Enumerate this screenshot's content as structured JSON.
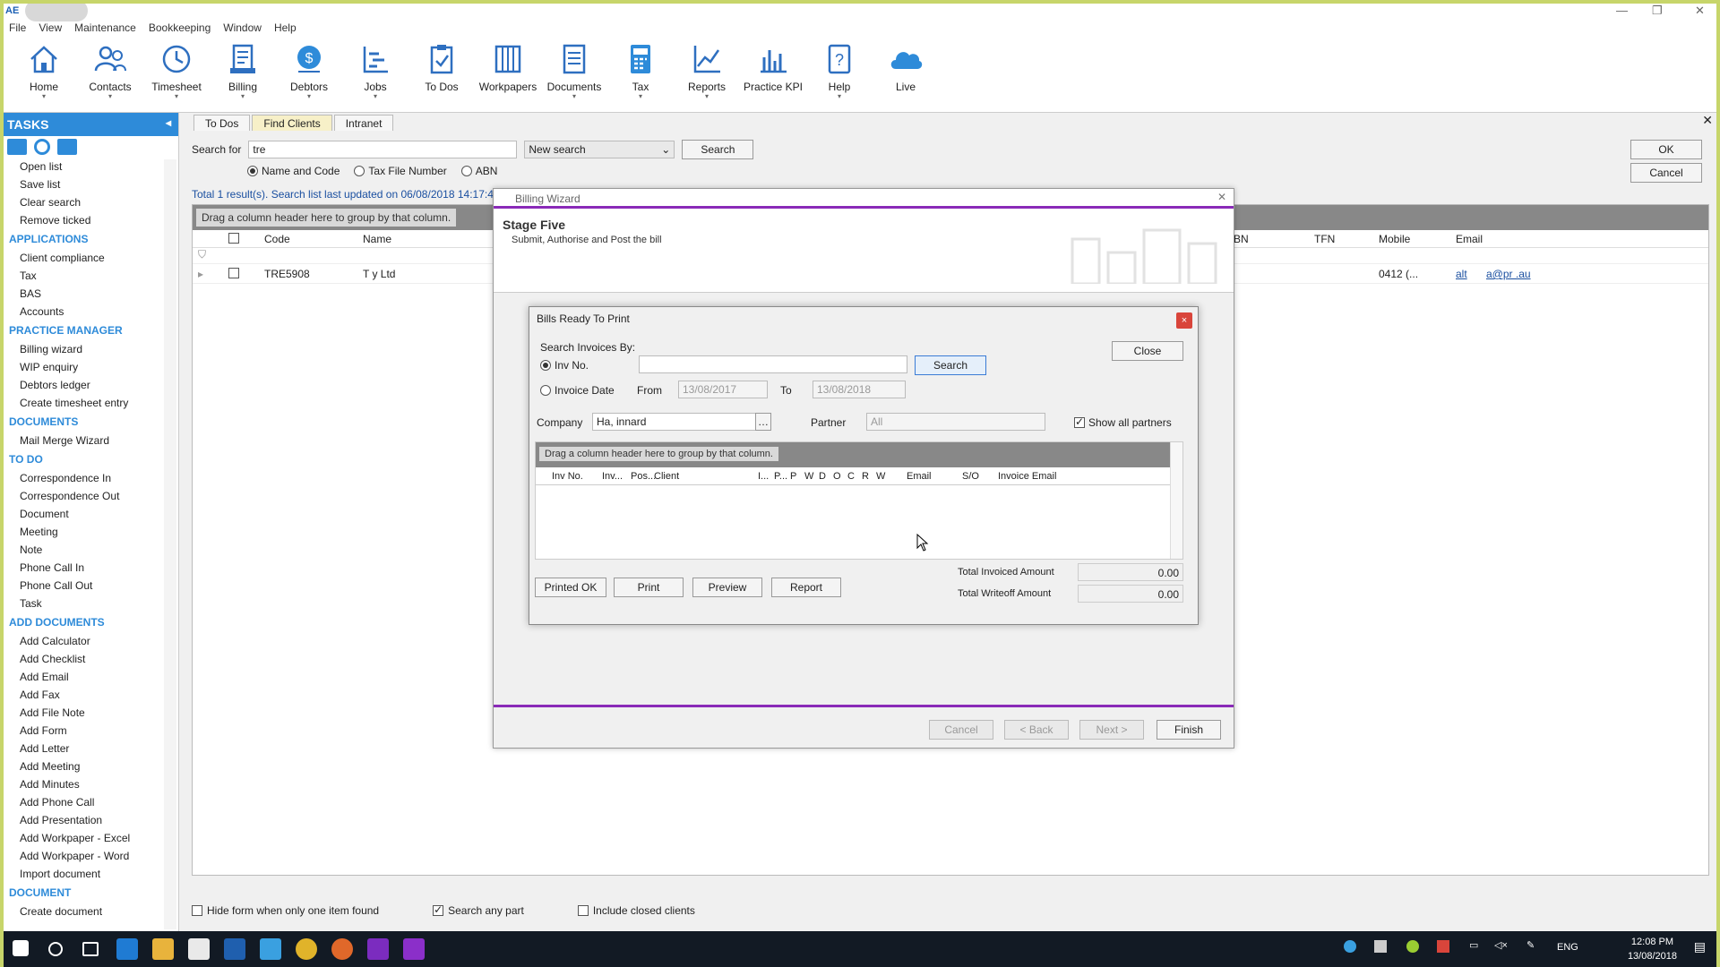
{
  "window": {
    "title_badge": "AE",
    "controls": [
      "—",
      "❐",
      "✕"
    ]
  },
  "menu": [
    "File",
    "View",
    "Maintenance",
    "Bookkeeping",
    "Window",
    "Help"
  ],
  "ribbon": [
    {
      "label": "Home",
      "icon": "home-icon"
    },
    {
      "label": "Contacts",
      "icon": "contacts-icon"
    },
    {
      "label": "Timesheet",
      "icon": "clock-icon"
    },
    {
      "label": "Billing",
      "icon": "billing-icon"
    },
    {
      "label": "Debtors",
      "icon": "debtors-icon"
    },
    {
      "label": "Jobs",
      "icon": "jobs-icon"
    },
    {
      "label": "To Dos",
      "icon": "todos-icon"
    },
    {
      "label": "Workpapers",
      "icon": "workpapers-icon"
    },
    {
      "label": "Documents",
      "icon": "documents-icon"
    },
    {
      "label": "Tax",
      "icon": "calculator-icon"
    },
    {
      "label": "Reports",
      "icon": "reports-icon"
    },
    {
      "label": "Practice KPI",
      "icon": "kpi-icon"
    },
    {
      "label": "Help",
      "icon": "help-icon"
    },
    {
      "label": "Live",
      "icon": "cloud-icon"
    }
  ],
  "sidebar": {
    "title": "TASKS",
    "entries": [
      {
        "t": "item",
        "label": "Open list"
      },
      {
        "t": "item",
        "label": "Save list"
      },
      {
        "t": "item",
        "label": "Clear search"
      },
      {
        "t": "item",
        "label": "Remove ticked"
      },
      {
        "t": "sec",
        "label": "APPLICATIONS"
      },
      {
        "t": "item",
        "label": "Client compliance"
      },
      {
        "t": "item",
        "label": "Tax"
      },
      {
        "t": "item",
        "label": "BAS"
      },
      {
        "t": "item",
        "label": "Accounts"
      },
      {
        "t": "sec",
        "label": "PRACTICE MANAGER"
      },
      {
        "t": "item",
        "label": "Billing wizard"
      },
      {
        "t": "item",
        "label": "WIP enquiry"
      },
      {
        "t": "item",
        "label": "Debtors ledger"
      },
      {
        "t": "item",
        "label": "Create timesheet entry"
      },
      {
        "t": "sec",
        "label": "DOCUMENTS"
      },
      {
        "t": "item",
        "label": "Mail Merge Wizard"
      },
      {
        "t": "sec",
        "label": "TO DO"
      },
      {
        "t": "item",
        "label": "Correspondence In"
      },
      {
        "t": "item",
        "label": "Correspondence Out"
      },
      {
        "t": "item",
        "label": "Document"
      },
      {
        "t": "item",
        "label": "Meeting"
      },
      {
        "t": "item",
        "label": "Note"
      },
      {
        "t": "item",
        "label": "Phone Call In"
      },
      {
        "t": "item",
        "label": "Phone Call Out"
      },
      {
        "t": "item",
        "label": "Task"
      },
      {
        "t": "sec",
        "label": "ADD DOCUMENTS"
      },
      {
        "t": "item",
        "label": "Add Calculator"
      },
      {
        "t": "item",
        "label": "Add Checklist"
      },
      {
        "t": "item",
        "label": "Add Email"
      },
      {
        "t": "item",
        "label": "Add Fax"
      },
      {
        "t": "item",
        "label": "Add File Note"
      },
      {
        "t": "item",
        "label": "Add Form"
      },
      {
        "t": "item",
        "label": "Add Letter"
      },
      {
        "t": "item",
        "label": "Add Meeting"
      },
      {
        "t": "item",
        "label": "Add Minutes"
      },
      {
        "t": "item",
        "label": "Add Phone Call"
      },
      {
        "t": "item",
        "label": "Add Presentation"
      },
      {
        "t": "item",
        "label": "Add Workpaper - Excel"
      },
      {
        "t": "item",
        "label": "Add Workpaper - Word"
      },
      {
        "t": "item",
        "label": "Import document"
      },
      {
        "t": "sec",
        "label": "DOCUMENT"
      },
      {
        "t": "item",
        "label": "Create document"
      }
    ]
  },
  "main": {
    "tabs": [
      "To Dos",
      "Find Clients",
      "Intranet"
    ],
    "search_label": "Search for",
    "search_value": "tre",
    "search_mode": "New search",
    "search_button": "Search",
    "ok": "OK",
    "cancel": "Cancel",
    "radios": [
      "Name and Code",
      "Tax File Number",
      "ABN"
    ],
    "status": "Total 1 result(s). Search list last updated on 06/08/2018 14:17:40",
    "group_hint": "Drag a column header here to group by that column.",
    "columns": {
      "code": "Code",
      "name": "Name",
      "abn": "BN",
      "tfn": "TFN",
      "mobile": "Mobile",
      "email": "Email"
    },
    "row": {
      "code": "TRE5908",
      "name": "T        y Ltd",
      "mobile": "0412          (...",
      "alt": "alt",
      "email": "a@pr           .au"
    },
    "footer": [
      "Hide form when only one item found",
      "Search any part",
      "Include closed clients"
    ]
  },
  "wizard": {
    "title": "Billing Wizard",
    "stage": "Stage Five",
    "subtitle": "Submit, Authorise and Post the bill",
    "buttons": [
      "Cancel",
      "< Back",
      "Next >",
      "Finish"
    ]
  },
  "bills": {
    "title": "Bills Ready To Print",
    "close_x": "×",
    "search_by": "Search Invoices By:",
    "inv_no": "Inv No.",
    "inv_date": "Invoice Date",
    "from": "From",
    "from_date": "13/08/2017",
    "to": "To",
    "to_date": "13/08/2018",
    "search_btn": "Search",
    "close_btn": "Close",
    "company_label": "Company",
    "company_value": "Ha,          innard",
    "partner_label": "Partner",
    "partner_value": "All",
    "show_all": "Show all partners",
    "group_hint": "Drag a column header here to group by that column.",
    "cols": [
      "Inv No.",
      "Inv...",
      "Pos...",
      "Client",
      "I...",
      "P...",
      "P",
      "W",
      "D",
      "O",
      "C",
      "R",
      "W",
      "Email",
      "S/O",
      "Invoice Email"
    ],
    "actions": [
      "Printed OK",
      "Print",
      "Preview",
      "Report"
    ],
    "total_invoiced_label": "Total Invoiced Amount",
    "total_invoiced": "0.00",
    "total_writeoff_label": "Total Writeoff Amount",
    "total_writeoff": "0.00"
  },
  "taskbar": {
    "lang": "ENG",
    "time": "12:08 PM",
    "date": "13/08/2018"
  }
}
